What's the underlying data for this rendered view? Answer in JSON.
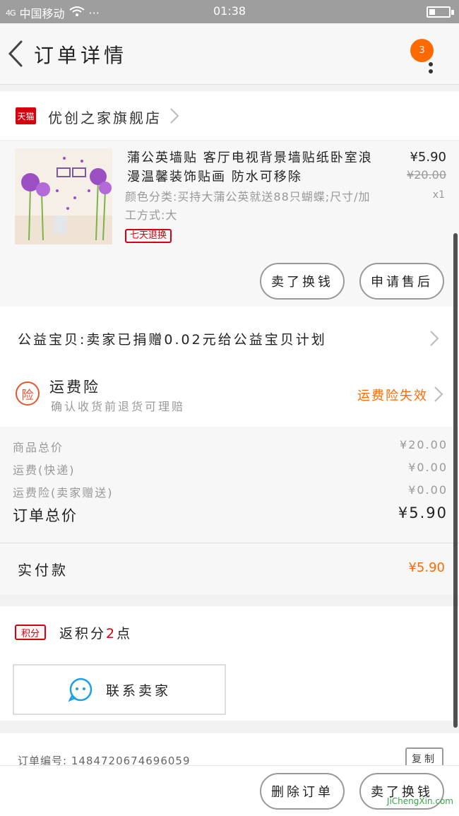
{
  "status_bar": {
    "signal": "4G",
    "carrier": "中国移动",
    "dots": "···",
    "time": "01:38"
  },
  "nav": {
    "title": "订单详情",
    "badge_count": "3"
  },
  "store": {
    "platform_label": "天猫",
    "name": "优创之家旗舰店"
  },
  "product": {
    "title": "蒲公英墙贴 客厅电视背景墙贴纸卧室浪漫温馨装饰贴画 防水可移除",
    "spec": "颜色分类:买持大蒲公英就送88只蝴蝶;尺寸/加工方式:大",
    "tag": "七天退换",
    "price": "¥5.90",
    "original_price": "¥20.00",
    "quantity": "x1",
    "buttons": {
      "buy_again": "卖了换钱",
      "after_sale": "申请售后"
    }
  },
  "charity": {
    "text": "公益宝贝:卖家已捐赠0.02元给公益宝贝计划"
  },
  "insurance": {
    "icon_text": "险",
    "title": "运费险",
    "subtitle": "确认收货前退货可理赔",
    "status": "运费险失效"
  },
  "summary": {
    "rows": [
      {
        "label": "商品总价",
        "value": "¥20.00"
      },
      {
        "label": "运费(快递)",
        "value": "¥0.00"
      },
      {
        "label": "运费险(卖家赠送)",
        "value": "¥0.00"
      }
    ],
    "total_label": "订单总价",
    "total_value": "¥5.90"
  },
  "paid": {
    "label": "实付款",
    "value": "¥5.90"
  },
  "points": {
    "badge": "积分",
    "text_prefix": "返积分",
    "count": "2",
    "text_suffix": "点"
  },
  "contact": {
    "label": "联系卖家"
  },
  "order": {
    "number_text": "订单编号: 1484720674696059",
    "copy_label": "复制"
  },
  "bottom_bar": {
    "delete_label": "删除订单",
    "sell_label": "卖了换钱"
  },
  "watermark": "JiChengXin.com",
  "colors": {
    "accent": "#ff6a00",
    "tmall_red": "#d7000f",
    "status_bar": "#9e9e9e"
  }
}
